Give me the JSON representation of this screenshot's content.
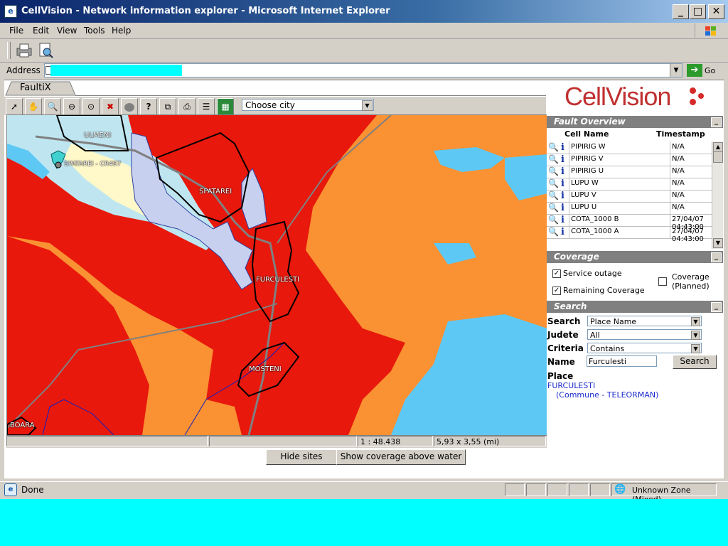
{
  "window": {
    "title": "CellVision - Network information explorer - Microsoft Internet Explorer"
  },
  "menu": [
    "File",
    "Edit",
    "View",
    "Tools",
    "Help"
  ],
  "address": {
    "label": "Address",
    "go_label": "Go"
  },
  "tab": {
    "label": "FaultiX"
  },
  "brand": {
    "logo": "CellVision",
    "color": "#c03030"
  },
  "map_toolbar": {
    "tools": [
      "select-arrow-icon",
      "pan-hand-icon",
      "zoom-in-icon",
      "zoom-out-icon",
      "zoom-extent-icon",
      "zoom-clear-icon",
      "circle-icon",
      "info-query-icon",
      "copy-icon",
      "print-icon",
      "legend-icon",
      "map-layers-icon"
    ],
    "city_select": "Choose city"
  },
  "map": {
    "labels": [
      "ULMENI",
      "SPATAREI - CR497",
      "SPATAREI",
      "FURCULESTI",
      "MOSTENI",
      "BOARA"
    ],
    "colors": {
      "strong": "#e8180c",
      "medium": "#fa9132",
      "weak": "#bfe6f0",
      "water": "#5ec8f5",
      "lake": "#c8d0f0"
    }
  },
  "map_status": {
    "cell1": "",
    "scale": "1 : 48.438",
    "extent": "5,93 x 3,55 (mi)"
  },
  "map_buttons": {
    "hide_sites": "Hide sites",
    "show_coverage": "Show coverage above water"
  },
  "fault_overview": {
    "title": "Fault Overview",
    "col_cell": "Cell Name",
    "col_time": "Timestamp",
    "rows": [
      {
        "name": "PIPIRIG W",
        "time": "N/A"
      },
      {
        "name": "PIPIRIG V",
        "time": "N/A"
      },
      {
        "name": "PIPIRIG U",
        "time": "N/A"
      },
      {
        "name": "LUPU W",
        "time": "N/A"
      },
      {
        "name": "LUPU V",
        "time": "N/A"
      },
      {
        "name": "LUPU U",
        "time": "N/A"
      },
      {
        "name": "COTA_1000 B",
        "time": "27/04/07 04:43:00"
      },
      {
        "name": "COTA_1000 A",
        "time": "27/04/07 04:43:00"
      }
    ]
  },
  "coverage": {
    "title": "Coverage",
    "service_outage": "Service outage",
    "remaining": "Remaining Coverage",
    "planned": "Coverage (Planned)",
    "service_outage_checked": true,
    "remaining_checked": true,
    "planned_checked": false
  },
  "search": {
    "title": "Search",
    "search_label": "Search",
    "search_value": "Place Name",
    "judete_label": "Judete",
    "judete_value": "All",
    "criteria_label": "Criteria",
    "criteria_value": "Contains",
    "name_label": "Name",
    "name_value": "Furculesti",
    "button": "Search",
    "result_heading": "Place",
    "result_name": "FURCULESTI",
    "result_detail": "(Commune - TELEORMAN)"
  },
  "status": {
    "text": "Done",
    "zone": "Unknown Zone (Mixed)"
  }
}
